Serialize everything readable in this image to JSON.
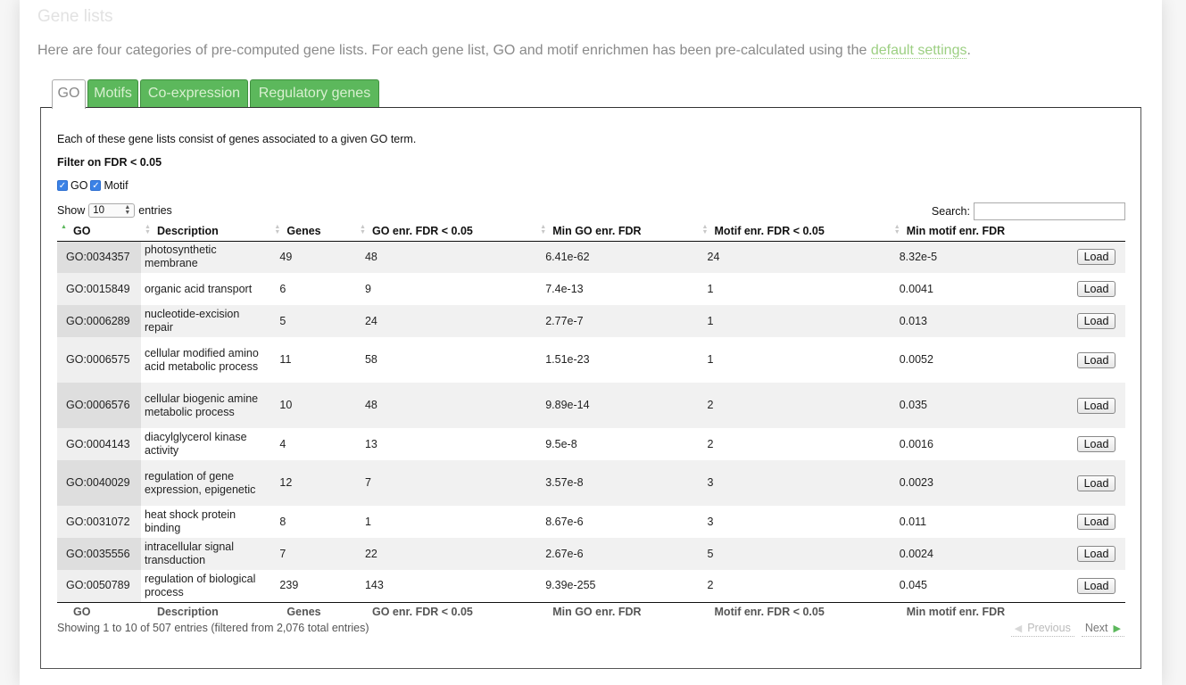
{
  "page": {
    "title": "Gene lists",
    "intro_text": "Here are four categories of pre-computed gene lists. For each gene list, GO and motif enrichmen has been pre-calculated using the ",
    "intro_link": "default settings",
    "intro_end": "."
  },
  "tabs": [
    {
      "label": "GO",
      "active": true
    },
    {
      "label": "Motifs",
      "active": false
    },
    {
      "label": "Co-expression",
      "active": false
    },
    {
      "label": "Regulatory genes",
      "active": false
    }
  ],
  "panel": {
    "description": "Each of these gene lists consist of genes associated to a given GO term.",
    "filter_title": "Filter on FDR < 0.05",
    "filter_go_label": "GO",
    "filter_motif_label": "Motif",
    "filter_go_checked": true,
    "filter_motif_checked": true,
    "show_label": "Show",
    "length_value": "10",
    "entries_label": "entries",
    "search_label": "Search:",
    "search_value": ""
  },
  "table": {
    "columns": [
      "GO",
      "Description",
      "Genes",
      "GO enr. FDR < 0.05",
      "Min GO enr. FDR",
      "Motif enr. FDR < 0.05",
      "Min motif enr. FDR"
    ],
    "sorted_column": "GO",
    "action_label": "Load",
    "rows": [
      {
        "go": "GO:0034357",
        "desc": "photosynthetic membrane",
        "genes": "49",
        "go_enr": "48",
        "min_go": "6.41e-62",
        "motif_enr": "24",
        "min_motif": "8.32e-5"
      },
      {
        "go": "GO:0015849",
        "desc": "organic acid transport",
        "genes": "6",
        "go_enr": "9",
        "min_go": "7.4e-13",
        "motif_enr": "1",
        "min_motif": "0.0041"
      },
      {
        "go": "GO:0006289",
        "desc": "nucleotide-excision repair",
        "genes": "5",
        "go_enr": "24",
        "min_go": "2.77e-7",
        "motif_enr": "1",
        "min_motif": "0.013"
      },
      {
        "go": "GO:0006575",
        "desc": "cellular modified amino acid metabolic process",
        "genes": "11",
        "go_enr": "58",
        "min_go": "1.51e-23",
        "motif_enr": "1",
        "min_motif": "0.0052"
      },
      {
        "go": "GO:0006576",
        "desc": "cellular biogenic amine metabolic process",
        "genes": "10",
        "go_enr": "48",
        "min_go": "9.89e-14",
        "motif_enr": "2",
        "min_motif": "0.035"
      },
      {
        "go": "GO:0004143",
        "desc": "diacylglycerol kinase activity",
        "genes": "4",
        "go_enr": "13",
        "min_go": "9.5e-8",
        "motif_enr": "2",
        "min_motif": "0.0016"
      },
      {
        "go": "GO:0040029",
        "desc": "regulation of gene expression, epigenetic",
        "genes": "12",
        "go_enr": "7",
        "min_go": "3.57e-8",
        "motif_enr": "3",
        "min_motif": "0.0023"
      },
      {
        "go": "GO:0031072",
        "desc": "heat shock protein binding",
        "genes": "8",
        "go_enr": "1",
        "min_go": "8.67e-6",
        "motif_enr": "3",
        "min_motif": "0.011"
      },
      {
        "go": "GO:0035556",
        "desc": "intracellular signal transduction",
        "genes": "7",
        "go_enr": "22",
        "min_go": "2.67e-6",
        "motif_enr": "5",
        "min_motif": "0.0024"
      },
      {
        "go": "GO:0050789",
        "desc": "regulation of biological process",
        "genes": "239",
        "go_enr": "143",
        "min_go": "9.39e-255",
        "motif_enr": "2",
        "min_motif": "0.045"
      }
    ]
  },
  "footer": {
    "info": "Showing 1 to 10 of 507 entries (filtered from 2,076 total entries)",
    "previous_label": "Previous",
    "next_label": "Next"
  },
  "colors": {
    "tab_green": "#5cb85c",
    "link_green": "#9ccf82"
  }
}
